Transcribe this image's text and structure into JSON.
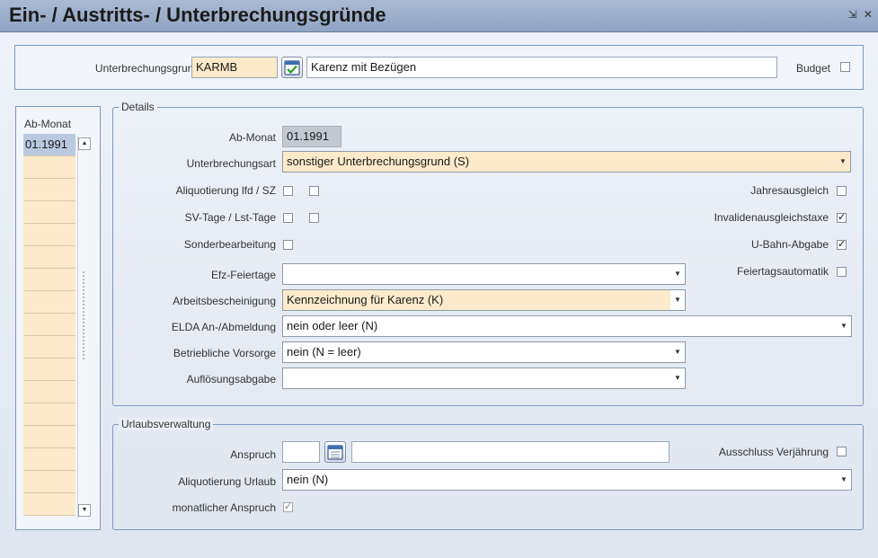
{
  "window": {
    "title": "Ein- / Austritts- / Unterbrechungsgründe",
    "controls": "⇲ ✕"
  },
  "header": {
    "unterbrechungsgrund_label": "Unterbrechungsgrund",
    "unterbrechungsgrund_code": "KARMB",
    "unterbrechungsgrund_text": "Karenz mit Bezügen",
    "budget_label": "Budget"
  },
  "month_list": {
    "header": "Ab-Monat",
    "items": [
      "01.1991"
    ]
  },
  "details": {
    "legend": "Details",
    "ab_monat_label": "Ab-Monat",
    "ab_monat_value": "01.1991",
    "unterbrechungsart_label": "Unterbrechungsart",
    "unterbrechungsart_value": "sonstiger Unterbrechungsgrund (S)",
    "aliquotierung_label": "Aliquotierung lfd / SZ",
    "svtage_label": "SV-Tage / Lst-Tage",
    "sonderbearbeitung_label": "Sonderbearbeitung",
    "jahresausgleich_label": "Jahresausgleich",
    "invaliden_label": "Invalidenausgleichstaxe",
    "ubahn_label": "U-Bahn-Abgabe",
    "feiertagsautomatik_label": "Feiertagsautomatik",
    "efz_label": "Efz-Feiertage",
    "efz_value": "",
    "arbeitsbescheinigung_label": "Arbeitsbescheinigung",
    "arbeitsbescheinigung_value": "Kennzeichnung für Karenz (K)",
    "elda_label": "ELDA An-/Abmeldung",
    "elda_value": "nein oder leer (N)",
    "vorsorge_label": "Betriebliche Vorsorge",
    "vorsorge_value": "nein (N = leer)",
    "aufloesung_label": "Auflösungsabgabe",
    "aufloesung_value": ""
  },
  "urlaub": {
    "legend": "Urlaubsverwaltung",
    "anspruch_label": "Anspruch",
    "anspruch_value": "",
    "anspruch_text": "",
    "ausschluss_label": "Ausschluss Verjährung",
    "aliquotierung_label": "Aliquotierung Urlaub",
    "aliquotierung_value": "nein (N)",
    "monatlich_label": "monatlicher Anspruch"
  },
  "checkboxes": {
    "budget": false,
    "aliquotierung_a": false,
    "aliquotierung_b": false,
    "svtage_a": false,
    "svtage_b": false,
    "sonderbearbeitung": false,
    "jahresausgleich": false,
    "invaliden": true,
    "ubahn": true,
    "feiertagsautomatik": false,
    "ausschluss": false,
    "monatlich": true
  },
  "icons": {
    "confirm": "check-calendar-icon",
    "calendar": "calendar-icon",
    "dropdown": "chevron-down-icon"
  }
}
